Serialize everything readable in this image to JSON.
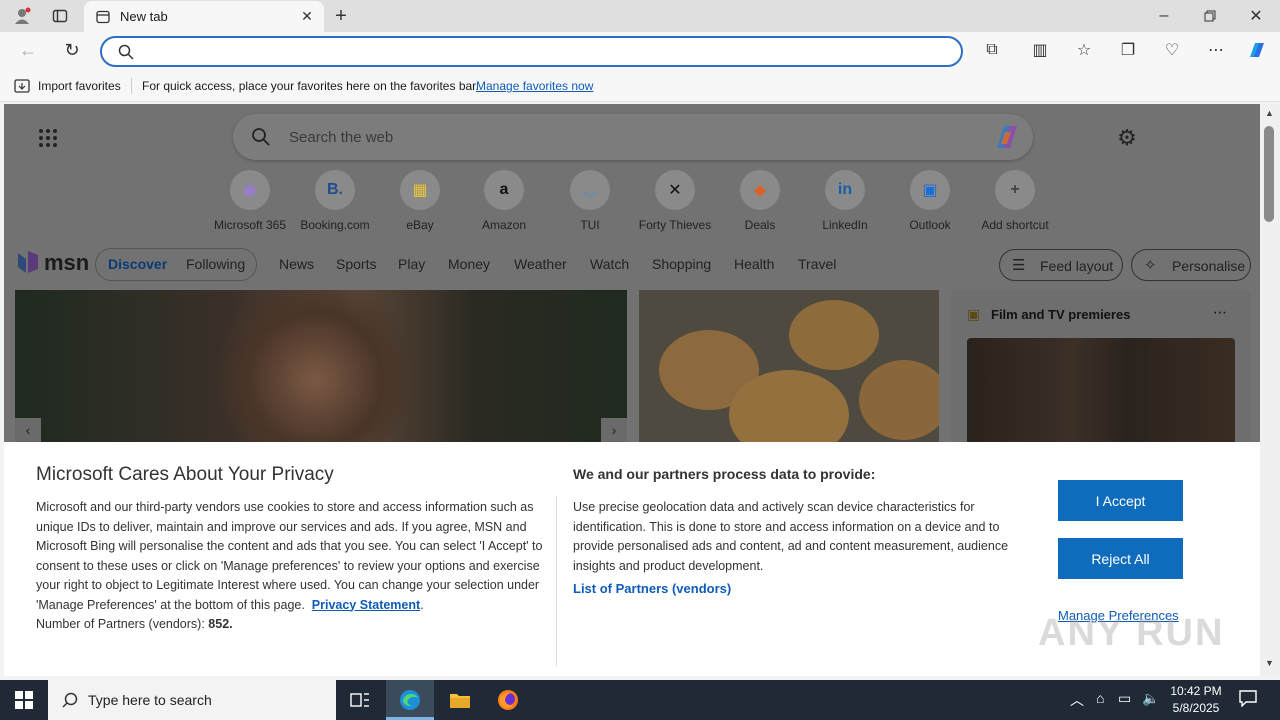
{
  "browser": {
    "tab_title": "New tab",
    "address_value": "",
    "favorites_bar": {
      "import_label": "Import favorites",
      "hint": "For quick access, place your favorites here on the favorites bar.",
      "manage_link": "Manage favorites now"
    }
  },
  "newtab": {
    "search_placeholder": "Search the web",
    "shortcuts": [
      {
        "label": "Microsoft 365",
        "icon": "microsoft365-icon",
        "glyph": "◉",
        "color": "#9b7bd6"
      },
      {
        "label": "Booking.com",
        "icon": "booking-icon",
        "glyph": "B.",
        "color": "#1f4e8c"
      },
      {
        "label": "eBay",
        "icon": "ebay-icon",
        "glyph": "▦",
        "color": "#e8c33b"
      },
      {
        "label": "Amazon",
        "icon": "amazon-icon",
        "glyph": "a",
        "color": "#111111"
      },
      {
        "label": "TUI",
        "icon": "tui-icon",
        "glyph": "◡",
        "color": "#3d8fe0"
      },
      {
        "label": "Forty Thieves",
        "icon": "forty-thieves-icon",
        "glyph": "✕",
        "color": "#111111"
      },
      {
        "label": "Deals",
        "icon": "deals-icon",
        "glyph": "◆",
        "color": "#d9642b"
      },
      {
        "label": "LinkedIn",
        "icon": "linkedin-icon",
        "glyph": "in",
        "color": "#1a5ea8"
      },
      {
        "label": "Outlook",
        "icon": "outlook-icon",
        "glyph": "▣",
        "color": "#1a6ed8"
      },
      {
        "label": "Add shortcut",
        "icon": "plus-icon",
        "glyph": "+",
        "color": "#444444"
      }
    ],
    "msn_logo": "msn",
    "pill_tabs": [
      "Discover",
      "Following"
    ],
    "nav": [
      "News",
      "Sports",
      "Play",
      "Money",
      "Weather",
      "Watch",
      "Shopping",
      "Health",
      "Travel"
    ],
    "feed_layout": "Feed layout",
    "personalise": "Personalise",
    "side_card_title": "Film and TV premieres"
  },
  "privacy": {
    "title": "Microsoft Cares About Your Privacy",
    "body": "Microsoft and our third-party vendors use cookies to store and access information such as unique IDs to deliver, maintain and improve our services and ads. If you agree, MSN and Microsoft Bing will personalise the content and ads that you see. You can select 'I Accept' to consent to these uses or click on 'Manage preferences' to review your options and exercise your right to object to Legitimate Interest where used.  You can change your selection under 'Manage Preferences' at the bottom of this page.",
    "privacy_link": "Privacy Statement",
    "partners_label": "Number of Partners (vendors):",
    "partners_count": "852.",
    "right_title": "We and our partners process data to provide:",
    "right_body": "Use precise geolocation data and actively scan device characteristics for identification. This is done to store and access information on a device and to provide personalised ads and content, ad and content measurement, audience insights and product development.",
    "partners_link": "List of Partners (vendors)",
    "accept": "I Accept",
    "reject": "Reject All",
    "manage": "Manage Preferences"
  },
  "taskbar": {
    "search_placeholder": "Type here to search",
    "time": "10:42 PM",
    "date": "5/8/2025"
  },
  "watermark": "ANY RUN"
}
